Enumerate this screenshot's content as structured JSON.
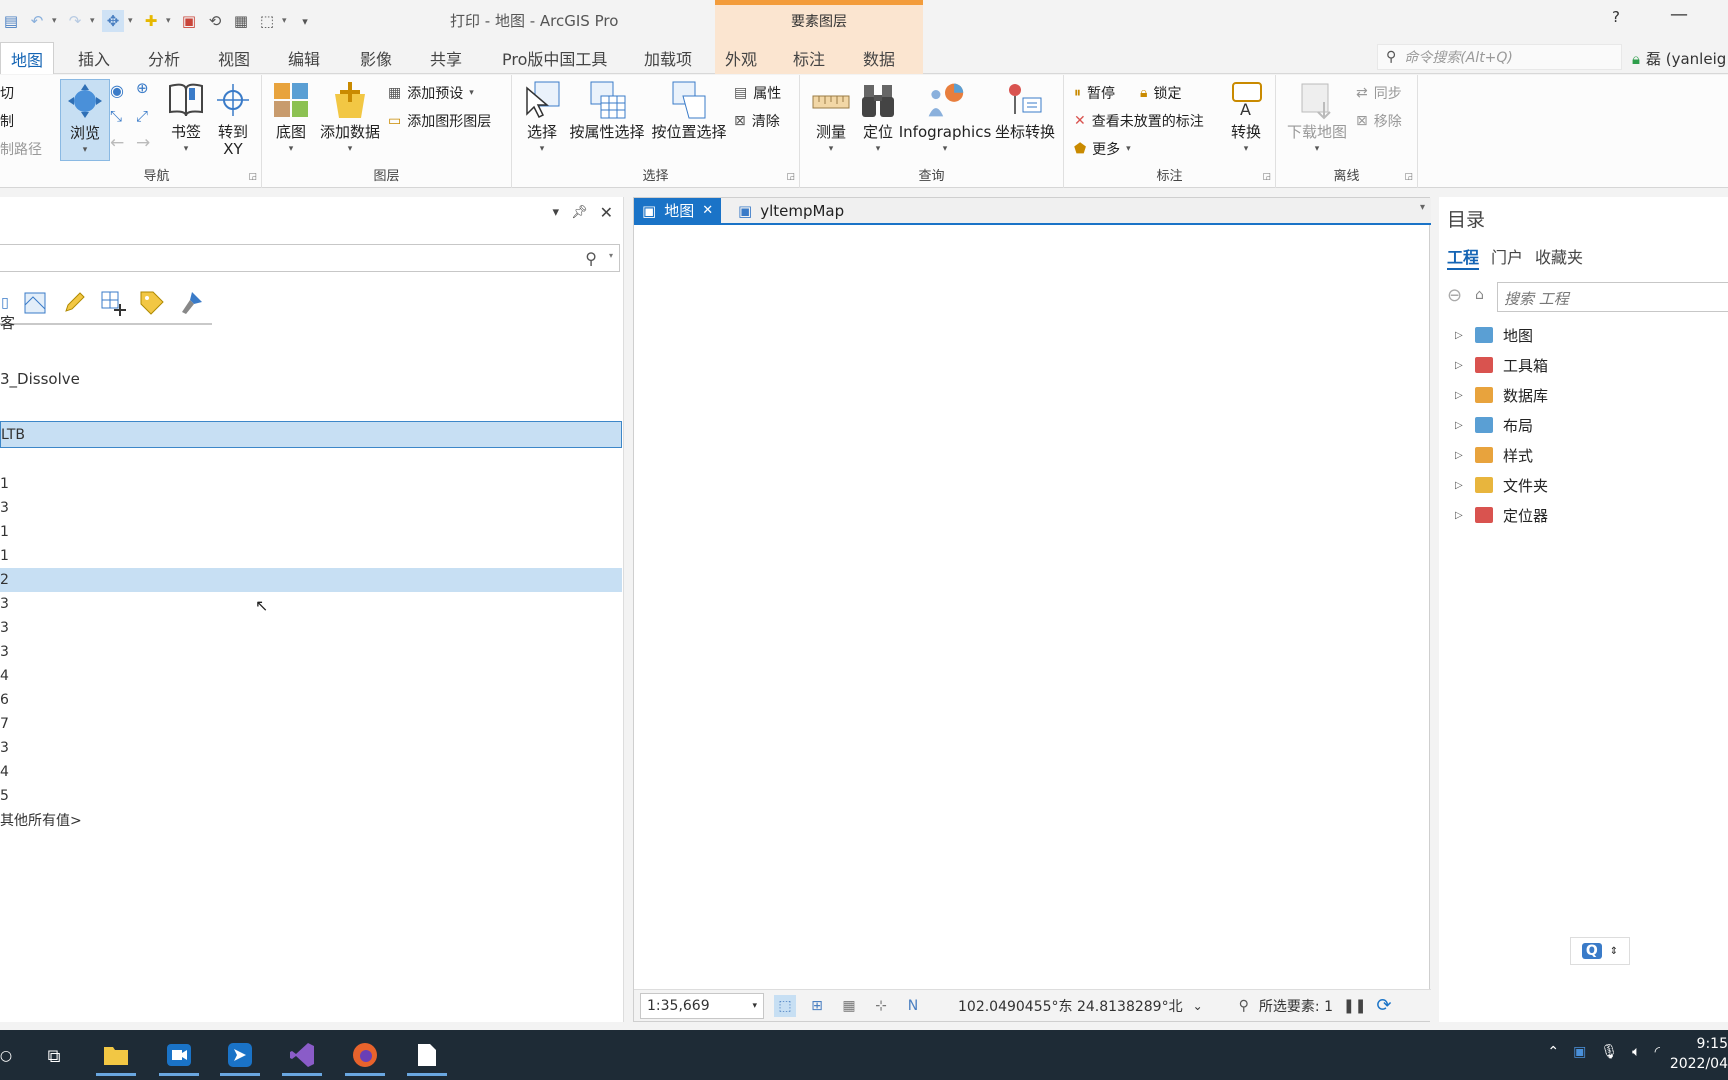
{
  "app": {
    "window_title": "打印 - 地图 - ArcGIS Pro",
    "context_tab_group": "要素图层",
    "help": "?",
    "minimize": "—"
  },
  "ribbon_tabs": [
    "地图",
    "插入",
    "分析",
    "视图",
    "编辑",
    "影像",
    "共享",
    "Pro版中国工具",
    "加载项",
    "外观",
    "标注",
    "数据"
  ],
  "command_search": {
    "placeholder": "命令搜索(Alt+Q)"
  },
  "user": {
    "label": "磊 (yanleig"
  },
  "ribbon": {
    "clipboard": {
      "cut": "切",
      "copy": "制",
      "copy_path": "制路径"
    },
    "navigate": {
      "label": "导航",
      "explore": "浏览",
      "bookmarks": "书签",
      "goto_xy_1": "转到",
      "goto_xy_2": "XY"
    },
    "layer": {
      "label": "图层",
      "basemap": "底图",
      "add_data": "添加数据",
      "add_preset": "添加预设",
      "add_graphics_layer": "添加图形图层"
    },
    "selection": {
      "label": "选择",
      "select": "选择",
      "select_by_attr": "按属性选择",
      "select_by_loc": "按位置选择",
      "attributes": "属性",
      "clear": "清除"
    },
    "inquiry": {
      "label": "查询",
      "measure": "测量",
      "locate": "定位",
      "infographics": "Infographics",
      "coord_convert": "坐标转换"
    },
    "labeling": {
      "label": "标注",
      "pause": "暂停",
      "lock": "锁定",
      "view_unplaced": "查看未放置的标注",
      "more": "更多",
      "convert": "转换"
    },
    "offline": {
      "label": "离线",
      "download_map": "下载地图",
      "sync": "同步",
      "remove": "移除"
    }
  },
  "left_pane": {
    "header_label_1": "客",
    "layer_name": "3_Dissolve",
    "field_name": "LTB",
    "values": [
      "1",
      "3",
      "1",
      "1",
      "2",
      "3",
      "3",
      "3",
      "4",
      "6",
      "7",
      "3",
      "4",
      "5"
    ],
    "other_values": "其他所有值>"
  },
  "map_view": {
    "tabs": [
      {
        "label": "地图",
        "active": true
      },
      {
        "label": "yltempMap",
        "active": false
      }
    ],
    "scale": "1:35,669",
    "coords": "102.0490455°东 24.8138289°北",
    "selected_features": "所选要素: 1"
  },
  "catalog": {
    "title": "目录",
    "tabs": [
      "工程",
      "门户",
      "收藏夹"
    ],
    "search_placeholder": "搜索 工程",
    "items": [
      {
        "label": "地图",
        "color": "#5a9fd4"
      },
      {
        "label": "工具箱",
        "color": "#d9534f"
      },
      {
        "label": "数据库",
        "color": "#e8a33d"
      },
      {
        "label": "布局",
        "color": "#5a9fd4"
      },
      {
        "label": "样式",
        "color": "#e8a33d"
      },
      {
        "label": "文件夹",
        "color": "#e8b53d"
      },
      {
        "label": "定位器",
        "color": "#d9534f"
      }
    ]
  },
  "taskbar": {
    "time": "9:15",
    "date": "2022/04"
  }
}
